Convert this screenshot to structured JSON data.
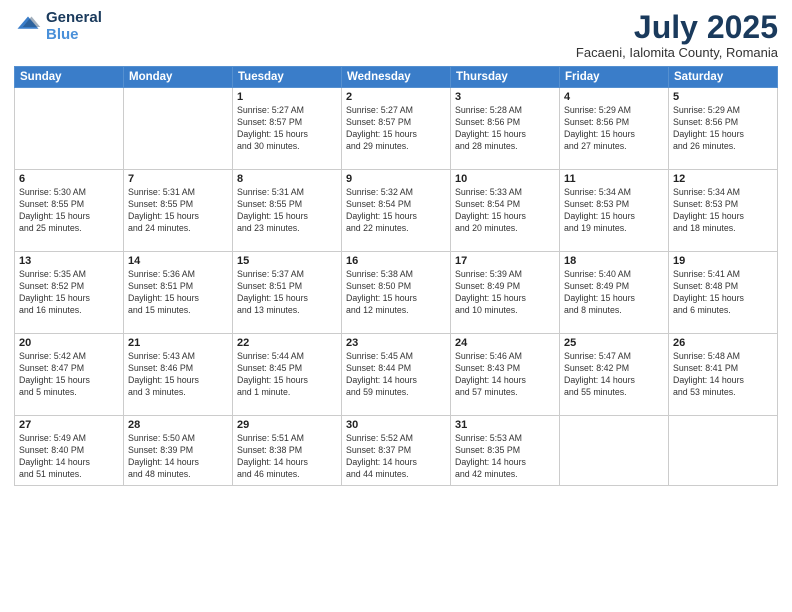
{
  "header": {
    "logo_line1": "General",
    "logo_line2": "Blue",
    "month": "July 2025",
    "location": "Facaeni, Ialomita County, Romania"
  },
  "days_of_week": [
    "Sunday",
    "Monday",
    "Tuesday",
    "Wednesday",
    "Thursday",
    "Friday",
    "Saturday"
  ],
  "weeks": [
    [
      {
        "day": "",
        "text": ""
      },
      {
        "day": "",
        "text": ""
      },
      {
        "day": "1",
        "text": "Sunrise: 5:27 AM\nSunset: 8:57 PM\nDaylight: 15 hours\nand 30 minutes."
      },
      {
        "day": "2",
        "text": "Sunrise: 5:27 AM\nSunset: 8:57 PM\nDaylight: 15 hours\nand 29 minutes."
      },
      {
        "day": "3",
        "text": "Sunrise: 5:28 AM\nSunset: 8:56 PM\nDaylight: 15 hours\nand 28 minutes."
      },
      {
        "day": "4",
        "text": "Sunrise: 5:29 AM\nSunset: 8:56 PM\nDaylight: 15 hours\nand 27 minutes."
      },
      {
        "day": "5",
        "text": "Sunrise: 5:29 AM\nSunset: 8:56 PM\nDaylight: 15 hours\nand 26 minutes."
      }
    ],
    [
      {
        "day": "6",
        "text": "Sunrise: 5:30 AM\nSunset: 8:55 PM\nDaylight: 15 hours\nand 25 minutes."
      },
      {
        "day": "7",
        "text": "Sunrise: 5:31 AM\nSunset: 8:55 PM\nDaylight: 15 hours\nand 24 minutes."
      },
      {
        "day": "8",
        "text": "Sunrise: 5:31 AM\nSunset: 8:55 PM\nDaylight: 15 hours\nand 23 minutes."
      },
      {
        "day": "9",
        "text": "Sunrise: 5:32 AM\nSunset: 8:54 PM\nDaylight: 15 hours\nand 22 minutes."
      },
      {
        "day": "10",
        "text": "Sunrise: 5:33 AM\nSunset: 8:54 PM\nDaylight: 15 hours\nand 20 minutes."
      },
      {
        "day": "11",
        "text": "Sunrise: 5:34 AM\nSunset: 8:53 PM\nDaylight: 15 hours\nand 19 minutes."
      },
      {
        "day": "12",
        "text": "Sunrise: 5:34 AM\nSunset: 8:53 PM\nDaylight: 15 hours\nand 18 minutes."
      }
    ],
    [
      {
        "day": "13",
        "text": "Sunrise: 5:35 AM\nSunset: 8:52 PM\nDaylight: 15 hours\nand 16 minutes."
      },
      {
        "day": "14",
        "text": "Sunrise: 5:36 AM\nSunset: 8:51 PM\nDaylight: 15 hours\nand 15 minutes."
      },
      {
        "day": "15",
        "text": "Sunrise: 5:37 AM\nSunset: 8:51 PM\nDaylight: 15 hours\nand 13 minutes."
      },
      {
        "day": "16",
        "text": "Sunrise: 5:38 AM\nSunset: 8:50 PM\nDaylight: 15 hours\nand 12 minutes."
      },
      {
        "day": "17",
        "text": "Sunrise: 5:39 AM\nSunset: 8:49 PM\nDaylight: 15 hours\nand 10 minutes."
      },
      {
        "day": "18",
        "text": "Sunrise: 5:40 AM\nSunset: 8:49 PM\nDaylight: 15 hours\nand 8 minutes."
      },
      {
        "day": "19",
        "text": "Sunrise: 5:41 AM\nSunset: 8:48 PM\nDaylight: 15 hours\nand 6 minutes."
      }
    ],
    [
      {
        "day": "20",
        "text": "Sunrise: 5:42 AM\nSunset: 8:47 PM\nDaylight: 15 hours\nand 5 minutes."
      },
      {
        "day": "21",
        "text": "Sunrise: 5:43 AM\nSunset: 8:46 PM\nDaylight: 15 hours\nand 3 minutes."
      },
      {
        "day": "22",
        "text": "Sunrise: 5:44 AM\nSunset: 8:45 PM\nDaylight: 15 hours\nand 1 minute."
      },
      {
        "day": "23",
        "text": "Sunrise: 5:45 AM\nSunset: 8:44 PM\nDaylight: 14 hours\nand 59 minutes."
      },
      {
        "day": "24",
        "text": "Sunrise: 5:46 AM\nSunset: 8:43 PM\nDaylight: 14 hours\nand 57 minutes."
      },
      {
        "day": "25",
        "text": "Sunrise: 5:47 AM\nSunset: 8:42 PM\nDaylight: 14 hours\nand 55 minutes."
      },
      {
        "day": "26",
        "text": "Sunrise: 5:48 AM\nSunset: 8:41 PM\nDaylight: 14 hours\nand 53 minutes."
      }
    ],
    [
      {
        "day": "27",
        "text": "Sunrise: 5:49 AM\nSunset: 8:40 PM\nDaylight: 14 hours\nand 51 minutes."
      },
      {
        "day": "28",
        "text": "Sunrise: 5:50 AM\nSunset: 8:39 PM\nDaylight: 14 hours\nand 48 minutes."
      },
      {
        "day": "29",
        "text": "Sunrise: 5:51 AM\nSunset: 8:38 PM\nDaylight: 14 hours\nand 46 minutes."
      },
      {
        "day": "30",
        "text": "Sunrise: 5:52 AM\nSunset: 8:37 PM\nDaylight: 14 hours\nand 44 minutes."
      },
      {
        "day": "31",
        "text": "Sunrise: 5:53 AM\nSunset: 8:35 PM\nDaylight: 14 hours\nand 42 minutes."
      },
      {
        "day": "",
        "text": ""
      },
      {
        "day": "",
        "text": ""
      }
    ]
  ]
}
